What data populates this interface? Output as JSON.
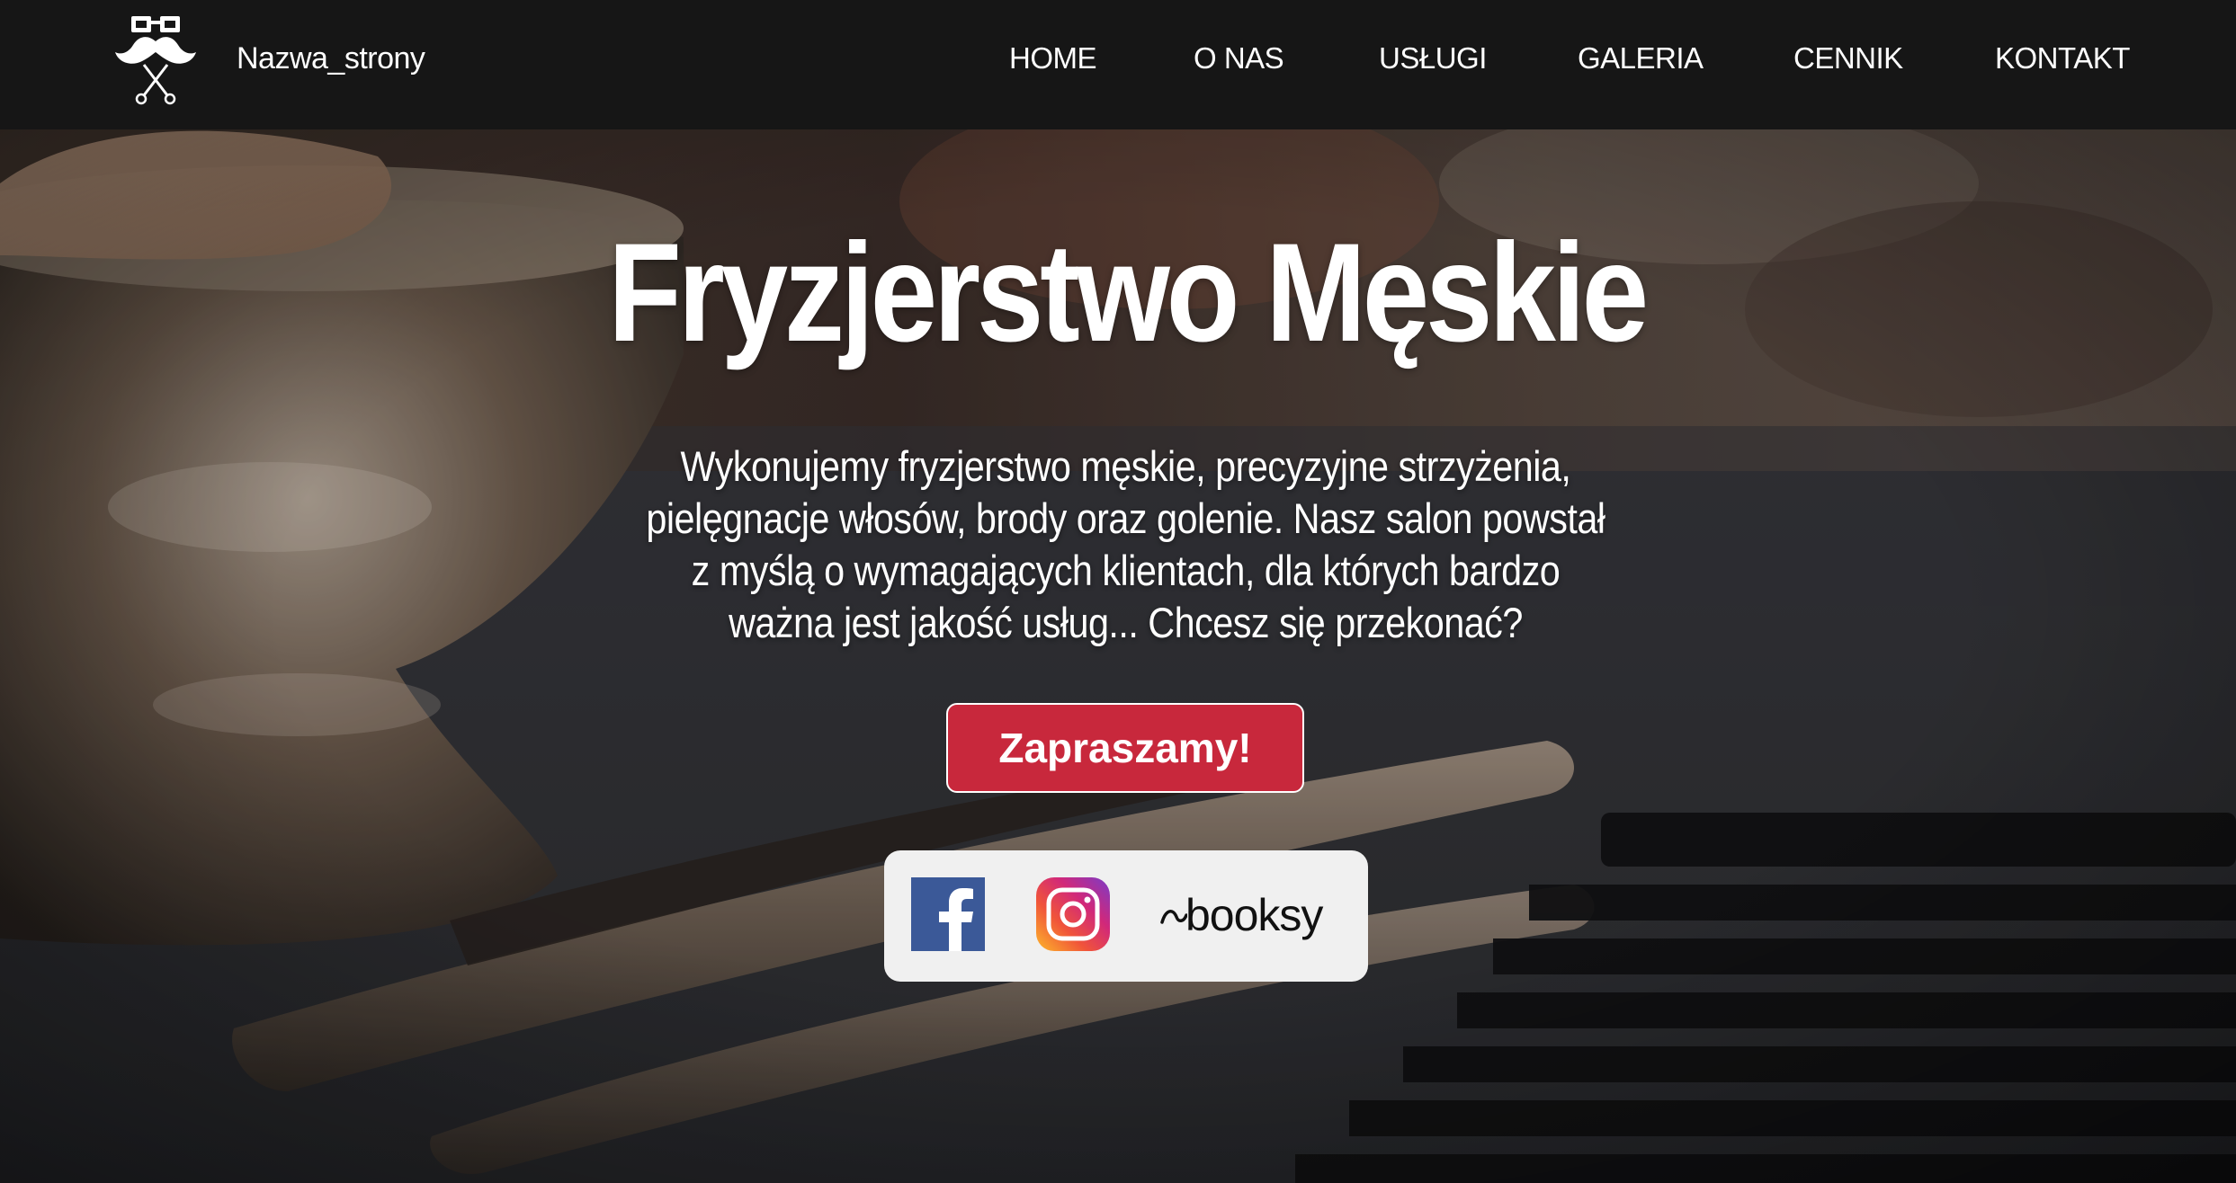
{
  "header": {
    "site_name": "Nazwa_strony",
    "logo_icon": "mustache-glasses-scissors-logo",
    "nav": [
      {
        "label": "HOME"
      },
      {
        "label": "O NAS"
      },
      {
        "label": "USŁUGI"
      },
      {
        "label": "GALERIA"
      },
      {
        "label": "CENNIK"
      },
      {
        "label": "KONTAKT"
      }
    ]
  },
  "hero": {
    "background_image": "barber-tools-straight-razor-shaving-bowl-photo",
    "title": "Fryzjerstwo Męskie",
    "description": "Wykonujemy fryzjerstwo męskie, precyzyjne strzyżenia, pielęgnacje włosów, brody oraz golenie. Nasz salon powstał z myślą o wymagających klientach, dla których bardzo ważna jest jakość usług... Chcesz się przekonać?",
    "cta_label": "Zapraszamy!"
  },
  "social": {
    "facebook_icon": "facebook-icon",
    "instagram_icon": "instagram-icon",
    "booksy_label": "booksy"
  },
  "colors": {
    "navbar_bg": "#161616",
    "cta_bg": "#c8283c",
    "social_bg": "#f0f0f0",
    "facebook_blue": "#3b5998"
  }
}
